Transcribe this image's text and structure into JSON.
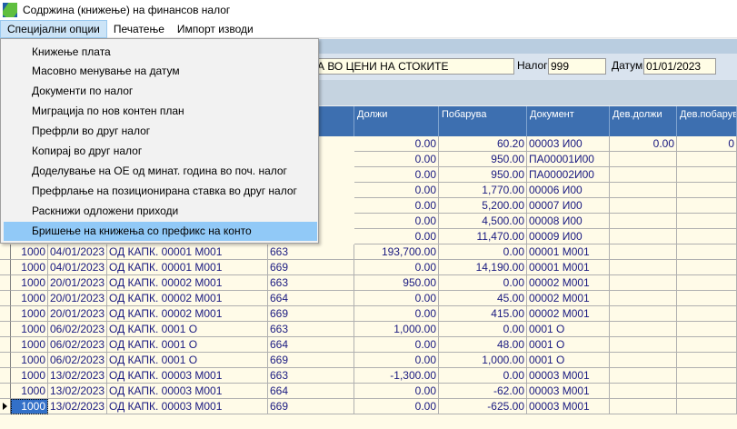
{
  "window": {
    "title": "Содржина (книжење) на финансов налог",
    "icon": "app-logo-icon"
  },
  "menubar": {
    "items": [
      "Специјални опции",
      "Печатење",
      "Импорт изводи"
    ]
  },
  "dropdown": {
    "items": [
      "Книжење плата",
      "Масовно менување на датум",
      "Документи по налог",
      "Миграција по нов контен план",
      "Префрли во друг налог",
      "Копирај во друг налог",
      "Доделување на ОЕ од минат. година во поч. налог",
      "Префрлање на позиционирана ставка во друг налог",
      "Раскнижи одложени приходи",
      "Бришење на книжења со префикс на конто"
    ],
    "highlighted_index": 9
  },
  "header": {
    "description": "КА ВО ЦЕНИ НА СТОКИТЕ",
    "nalog_label": "Налог",
    "nalog_value": "999",
    "datum_label": "Датум",
    "datum_value": "01/01/2023"
  },
  "grid": {
    "columns": [
      "Должи",
      "Побарува",
      "Документ",
      "Дев.должи",
      "Дев.побарув"
    ],
    "partial_rows": [
      {
        "dolzi": "0.00",
        "pobaruva": "60.20",
        "dokument": "00003  И00",
        "dev_dolzi": "0.00",
        "dev_pobaruva": "0"
      },
      {
        "dolzi": "0.00",
        "pobaruva": "950.00",
        "dokument": "ПА00001И00",
        "dev_dolzi": "",
        "dev_pobaruva": ""
      },
      {
        "dolzi": "0.00",
        "pobaruva": "950.00",
        "dokument": "ПА00002И00",
        "dev_dolzi": "",
        "dev_pobaruva": ""
      },
      {
        "dolzi": "0.00",
        "pobaruva": "1,770.00",
        "dokument": "00006  И00",
        "dev_dolzi": "",
        "dev_pobaruva": ""
      },
      {
        "dolzi": "0.00",
        "pobaruva": "5,200.00",
        "dokument": "00007  И00",
        "dev_dolzi": "",
        "dev_pobaruva": ""
      },
      {
        "dolzi": "0.00",
        "pobaruva": "4,500.00",
        "dokument": "00008  И00",
        "dev_dolzi": "",
        "dev_pobaruva": ""
      },
      {
        "dolzi": "0.00",
        "pobaruva": "11,470.00",
        "dokument": "00009  И00",
        "dev_dolzi": "",
        "dev_pobaruva": ""
      }
    ],
    "rows": [
      {
        "sifra": "1000",
        "datum": "04/01/2023",
        "opis": "ОД КАПК. 00001  М001",
        "konto": "663",
        "dolzi": "193,700.00",
        "pobaruva": "0.00",
        "dokument": "00001  М001",
        "dev_dolzi": "",
        "dev_pobaruva": ""
      },
      {
        "sifra": "1000",
        "datum": "04/01/2023",
        "opis": "ОД КАПК. 00001  М001",
        "konto": "669",
        "dolzi": "0.00",
        "pobaruva": "14,190.00",
        "dokument": "00001  М001",
        "dev_dolzi": "",
        "dev_pobaruva": ""
      },
      {
        "sifra": "1000",
        "datum": "20/01/2023",
        "opis": "ОД КАПК. 00002  М001",
        "konto": "663",
        "dolzi": "950.00",
        "pobaruva": "0.00",
        "dokument": "00002  М001",
        "dev_dolzi": "",
        "dev_pobaruva": ""
      },
      {
        "sifra": "1000",
        "datum": "20/01/2023",
        "opis": "ОД КАПК. 00002  М001",
        "konto": "664",
        "dolzi": "0.00",
        "pobaruva": "45.00",
        "dokument": "00002  М001",
        "dev_dolzi": "",
        "dev_pobaruva": ""
      },
      {
        "sifra": "1000",
        "datum": "20/01/2023",
        "opis": "ОД КАПК. 00002  М001",
        "konto": "669",
        "dolzi": "0.00",
        "pobaruva": "415.00",
        "dokument": "00002  М001",
        "dev_dolzi": "",
        "dev_pobaruva": ""
      },
      {
        "sifra": "1000",
        "datum": "06/02/2023",
        "opis": "ОД КАПК. 0001   О",
        "konto": "663",
        "dolzi": "1,000.00",
        "pobaruva": "0.00",
        "dokument": "0001   О",
        "dev_dolzi": "",
        "dev_pobaruva": ""
      },
      {
        "sifra": "1000",
        "datum": "06/02/2023",
        "opis": "ОД КАПК. 0001   О",
        "konto": "664",
        "dolzi": "0.00",
        "pobaruva": "48.00",
        "dokument": "0001   О",
        "dev_dolzi": "",
        "dev_pobaruva": ""
      },
      {
        "sifra": "1000",
        "datum": "06/02/2023",
        "opis": "ОД КАПК. 0001   О",
        "konto": "669",
        "dolzi": "0.00",
        "pobaruva": "1,000.00",
        "dokument": "0001   О",
        "dev_dolzi": "",
        "dev_pobaruva": ""
      },
      {
        "sifra": "1000",
        "datum": "13/02/2023",
        "opis": "ОД КАПК. 00003  М001",
        "konto": "663",
        "dolzi": "-1,300.00",
        "pobaruva": "0.00",
        "dokument": "00003  М001",
        "dev_dolzi": "",
        "dev_pobaruva": ""
      },
      {
        "sifra": "1000",
        "datum": "13/02/2023",
        "opis": "ОД КАПК. 00003  М001",
        "konto": "664",
        "dolzi": "0.00",
        "pobaruva": "-62.00",
        "dokument": "00003  М001",
        "dev_dolzi": "",
        "dev_pobaruva": ""
      },
      {
        "sifra": "1000",
        "datum": "13/02/2023",
        "opis": "ОД КАПК. 00003  М001",
        "konto": "669",
        "dolzi": "0.00",
        "pobaruva": "-625.00",
        "dokument": "00003  М001",
        "dev_dolzi": "",
        "dev_pobaruva": ""
      }
    ],
    "selected_row_index": 10
  }
}
